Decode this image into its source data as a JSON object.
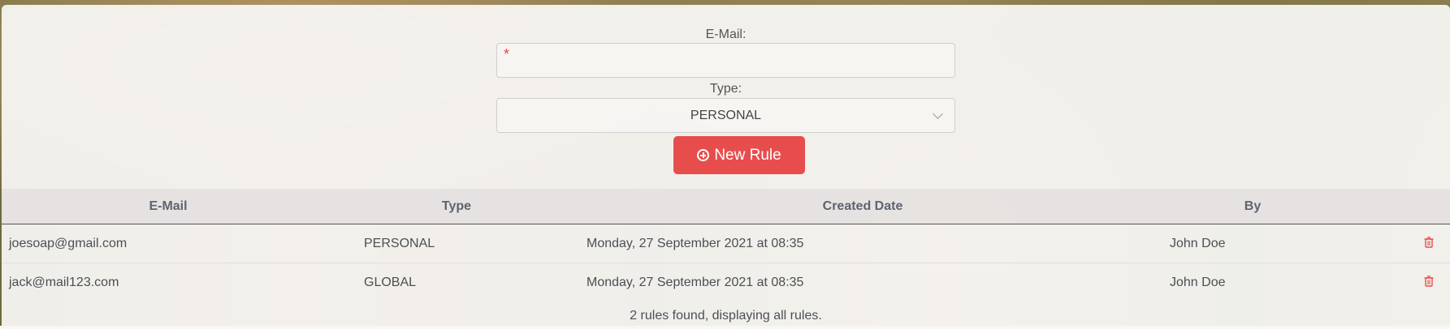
{
  "form": {
    "email_label": "E-Mail:",
    "email_required_marker": "*",
    "email_value": "",
    "type_label": "Type:",
    "type_selected": "PERSONAL",
    "new_rule_label": "New Rule"
  },
  "table": {
    "headers": [
      "E-Mail",
      "Type",
      "Created Date",
      "By"
    ],
    "rows": [
      {
        "email": "joesoap@gmail.com",
        "type": "PERSONAL",
        "created": "Monday, 27 September 2021 at 08:35",
        "by": "John Doe"
      },
      {
        "email": "jack@mail123.com",
        "type": "GLOBAL",
        "created": "Monday, 27 September 2021 at 08:35",
        "by": "John Doe"
      }
    ],
    "footer": "2 rules found, displaying all rules."
  },
  "colors": {
    "accent": "#e84d4d",
    "required": "#e84545"
  }
}
